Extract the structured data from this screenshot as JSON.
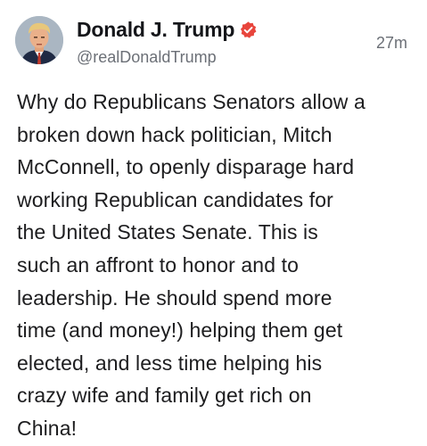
{
  "author": {
    "display_name": "Donald J. Trump",
    "handle": "@realDonaldTrump",
    "verified_icon": "verified-badge-icon",
    "verified_color": "#e8453c"
  },
  "timestamp": "27m",
  "post": {
    "text": "Why do Republicans Senators allow a\nbroken down hack politician, Mitch\nMcConnell, to openly disparage hard\nworking Republican candidates for\nthe United States Senate. This is\nsuch an affront to honor and to\nleadership. He should spend more\ntime (and money!) helping them get\nelected, and less time helping his\ncrazy wife and family get rich on\nChina!"
  }
}
